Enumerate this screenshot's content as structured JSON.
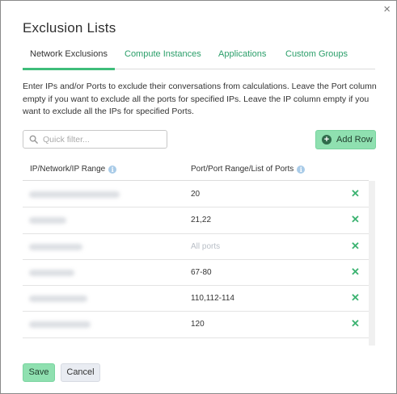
{
  "dialog": {
    "title": "Exclusion Lists",
    "close_icon": "×"
  },
  "tabs": [
    {
      "label": "Network Exclusions",
      "active": true
    },
    {
      "label": "Compute Instances",
      "active": false
    },
    {
      "label": "Applications",
      "active": false
    },
    {
      "label": "Custom Groups",
      "active": false
    }
  ],
  "description": "Enter IPs and/or Ports to exclude their conversations from calculations. Leave the Port column empty if you want to exclude all the ports for specified IPs. Leave the IP column empty if you want to exclude all the IPs for specified Ports.",
  "filter": {
    "placeholder": "Quick filter..."
  },
  "add_row": {
    "label": "Add Row"
  },
  "table": {
    "columns": [
      "IP/Network/IP Range",
      "Port/Port Range/List of Ports"
    ],
    "rows": [
      {
        "port": "20",
        "port_is_placeholder": false
      },
      {
        "port": "21,22",
        "port_is_placeholder": false
      },
      {
        "port": "All ports",
        "port_is_placeholder": true
      },
      {
        "port": "67-80",
        "port_is_placeholder": false
      },
      {
        "port": "110,112-114",
        "port_is_placeholder": false
      },
      {
        "port": "120",
        "port_is_placeholder": false
      }
    ]
  },
  "footer": {
    "save_label": "Save",
    "cancel_label": "Cancel"
  },
  "colors": {
    "accent": "#3ebd7a",
    "link": "#2a9e69",
    "button_green": "#8fe0b0"
  }
}
